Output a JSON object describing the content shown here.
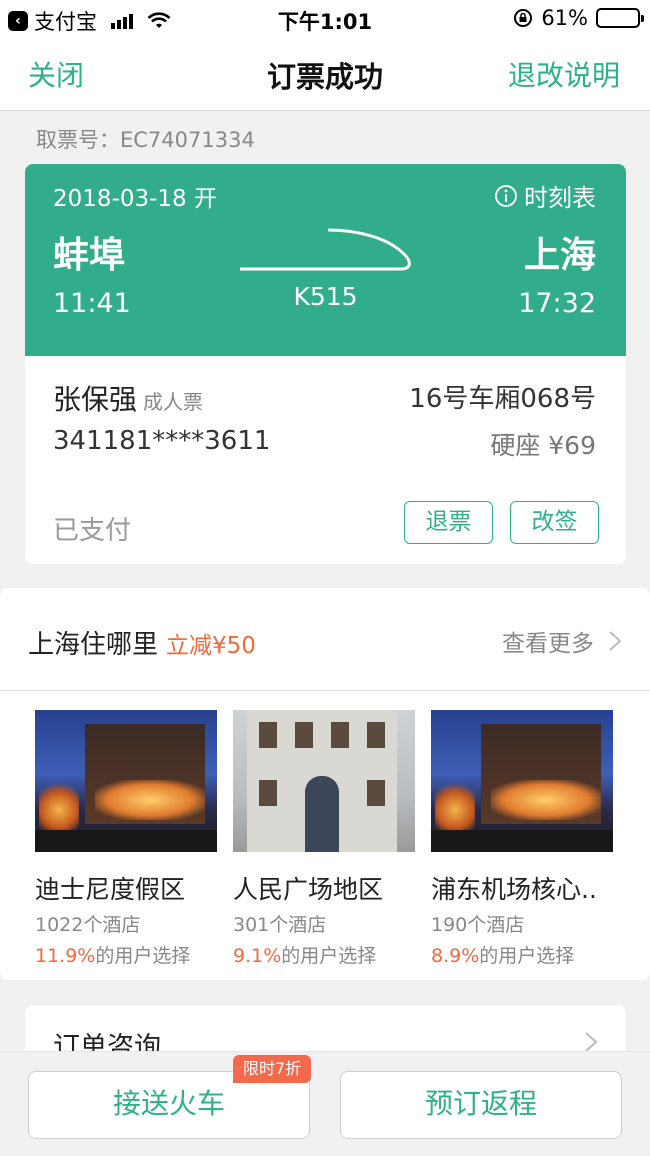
{
  "status_bar": {
    "app_name": "支付宝",
    "time": "下午1:01",
    "battery": "61%"
  },
  "nav": {
    "close": "关闭",
    "title": "订票成功",
    "refund_info": "退改说明"
  },
  "pickup_code": "取票号：EC74071334",
  "ticket": {
    "date": "2018-03-18 开",
    "timetable": "时刻表",
    "from_station": "蚌埠",
    "to_station": "上海",
    "dep_time": "11:41",
    "arr_time": "17:32",
    "train_no": "K515",
    "passenger_name": "张保强",
    "ticket_type": "成人票",
    "seat_no": "16号车厢068号",
    "id_no": "341181****3611",
    "seat_price": "硬座 ¥69",
    "pay_status": "已支付",
    "refund_button": "退票",
    "change_button": "改签"
  },
  "hotels": {
    "title": "上海住哪里",
    "discount": "立减¥50",
    "more": "查看更多",
    "items": [
      {
        "name": "迪士尼度假区",
        "count": "1022个酒店",
        "pct": "11.9%",
        "choice_suffix": "的用户选择"
      },
      {
        "name": "人民广场地区",
        "count": "301个酒店",
        "pct": "9.1%",
        "choice_suffix": "的用户选择"
      },
      {
        "name": "浦东机场核心..",
        "count": "190个酒店",
        "pct": "8.9%",
        "choice_suffix": "的用户选择"
      }
    ]
  },
  "consult": {
    "label": "订单咨询"
  },
  "bottom": {
    "pickup_train": "接送火车",
    "promo": "限时7折",
    "book_return": "预订返程"
  },
  "colors": {
    "accent": "#2fb08c",
    "ticket_header": "#32ad8c",
    "highlight": "#f2683a"
  }
}
